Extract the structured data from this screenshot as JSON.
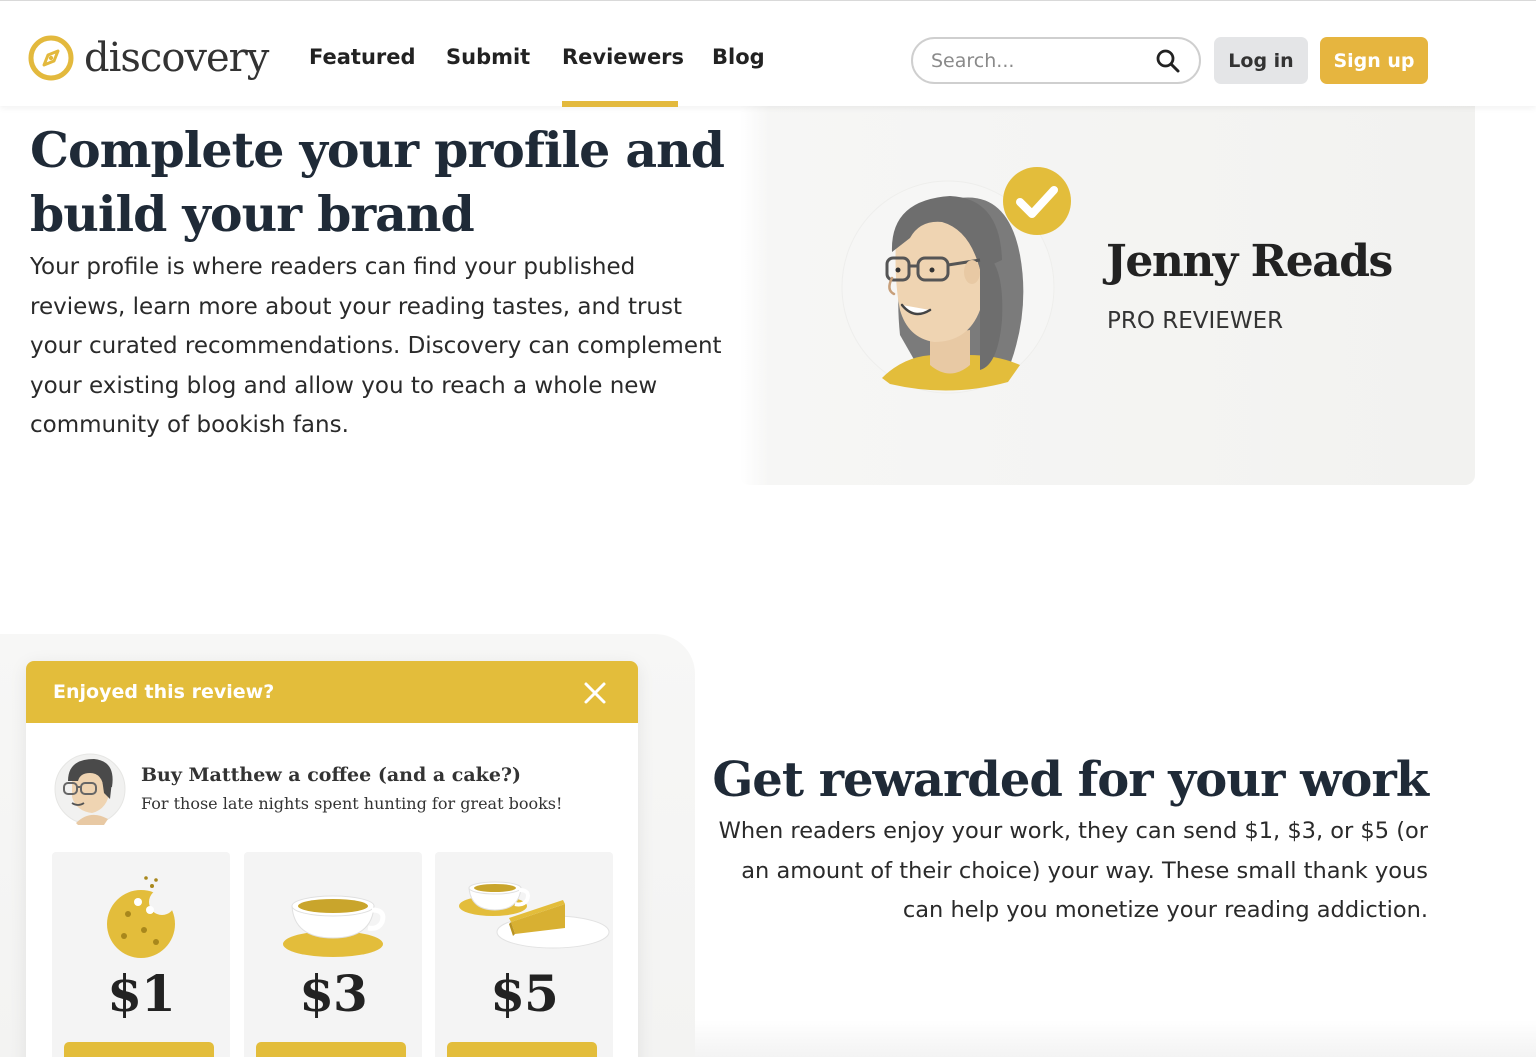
{
  "header": {
    "logo_text": "discovery",
    "nav": [
      {
        "label": "Featured"
      },
      {
        "label": "Submit"
      },
      {
        "label": "Reviewers",
        "active": true
      },
      {
        "label": "Blog"
      }
    ],
    "search": {
      "placeholder": "Search..."
    },
    "login_label": "Log in",
    "signup_label": "Sign up"
  },
  "profile_section": {
    "title": "Complete your profile and build your brand",
    "body": "Your profile is where readers can find your published reviews, learn more about your reading tastes, and trust your curated recommendations. Discovery can complement your existing blog and allow you to reach a whole new community of bookish fans.",
    "card": {
      "name": "Jenny Reads",
      "role": "PRO REVIEWER",
      "verified_icon": "check-circle-icon"
    }
  },
  "reward_section": {
    "title": "Get rewarded for your work",
    "body": "When readers enjoy your work, they can send $1, $3, or $5 (or an amount of their choice) your way. These small thank yous can help you monetize your reading addiction.",
    "modal": {
      "title": "Enjoyed this review?",
      "buy_title": "Buy Matthew a coffee (and a cake?)",
      "buy_subtitle": "For those late nights spent hunting for great books!",
      "tiers": [
        {
          "amount": "$1",
          "icon": "cookie-icon"
        },
        {
          "amount": "$3",
          "icon": "coffee-cup-icon"
        },
        {
          "amount": "$5",
          "icon": "coffee-and-cake-icon"
        }
      ]
    }
  },
  "colors": {
    "accent": "#e3bd3b",
    "heading": "#1f2a37",
    "text": "#2a2a2a",
    "login_bg": "#e4e5e7"
  }
}
